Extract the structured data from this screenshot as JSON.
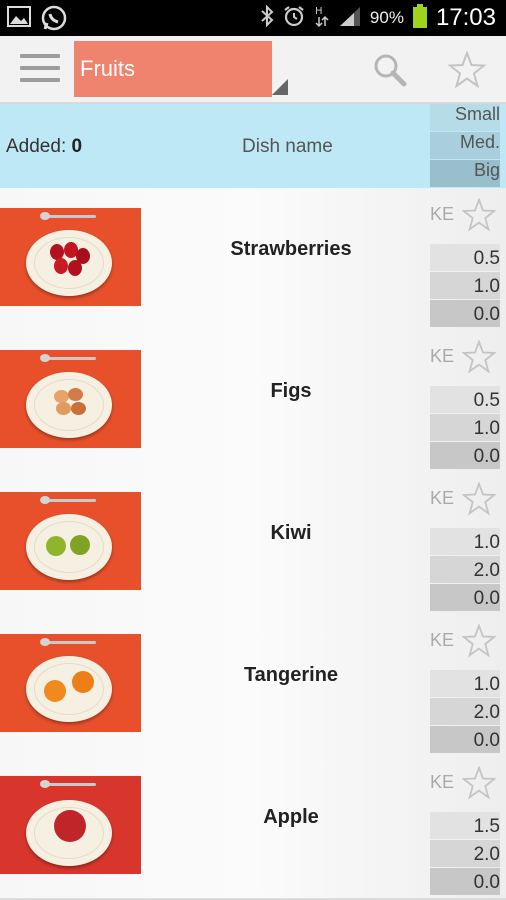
{
  "status_bar": {
    "battery": "90%",
    "time": "17:03",
    "icons": [
      "gallery-icon",
      "whatsapp-icon",
      "bluetooth-icon",
      "alarm-icon",
      "hsdpa-icon",
      "signal-icon",
      "battery-icon"
    ]
  },
  "toolbar": {
    "category": "Fruits"
  },
  "header": {
    "added_label": "Added:",
    "added_count": "0",
    "dish_name": "Dish name",
    "sizes": [
      "Small",
      "Med.",
      "Big"
    ]
  },
  "colors": {
    "accent": "#f0836d",
    "header_bg": "#bfe8f6",
    "thumb_bg": "#e8502c"
  },
  "items": [
    {
      "name": "Strawberries",
      "ke_label": "KE",
      "values": [
        "0.5",
        "1.0",
        "0.0"
      ]
    },
    {
      "name": "Figs",
      "ke_label": "KE",
      "values": [
        "0.5",
        "1.0",
        "0.0"
      ]
    },
    {
      "name": "Kiwi",
      "ke_label": "KE",
      "values": [
        "1.0",
        "2.0",
        "0.0"
      ]
    },
    {
      "name": "Tangerine",
      "ke_label": "KE",
      "values": [
        "1.0",
        "2.0",
        "0.0"
      ]
    },
    {
      "name": "Apple",
      "ke_label": "KE",
      "values": [
        "1.5",
        "2.0",
        "0.0"
      ]
    }
  ]
}
